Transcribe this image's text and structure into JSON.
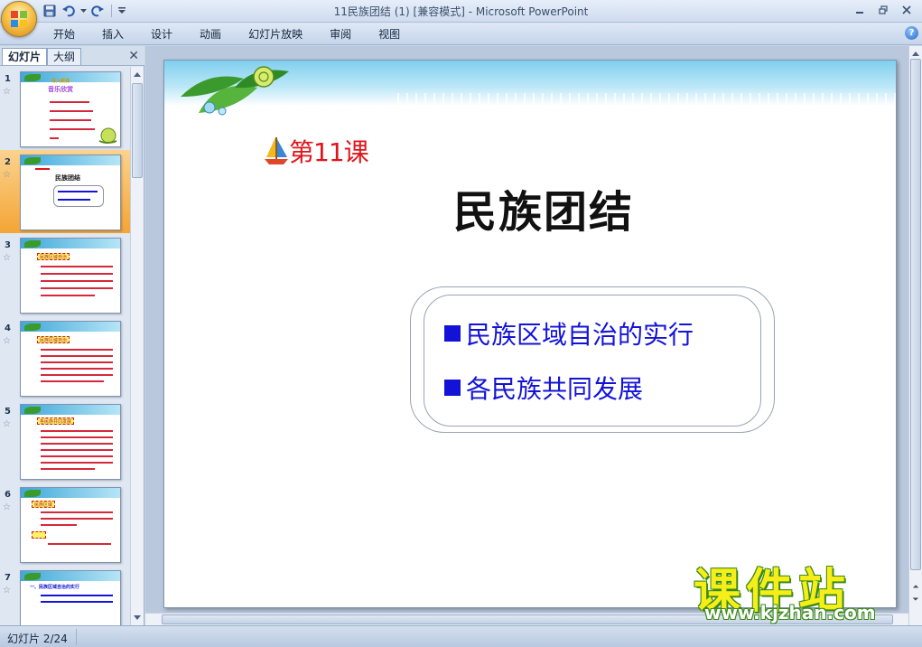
{
  "window": {
    "title": "11民族团结 (1) [兼容模式] - Microsoft PowerPoint"
  },
  "qat": {
    "icons": [
      "save-icon",
      "undo-icon",
      "dropdown-arrow-icon",
      "redo-icon",
      "customize-icon"
    ]
  },
  "ribbon": {
    "tabs": [
      {
        "label": "开始"
      },
      {
        "label": "插入"
      },
      {
        "label": "设计"
      },
      {
        "label": "动画"
      },
      {
        "label": "幻灯片放映"
      },
      {
        "label": "审阅"
      },
      {
        "label": "视图"
      }
    ],
    "help": "?"
  },
  "panel": {
    "tabs": [
      {
        "label": "幻灯片"
      },
      {
        "label": "大纲"
      }
    ],
    "close": "✕",
    "slides": [
      {
        "number": "1",
        "star": "☆",
        "title": "音乐欣赏",
        "subtitle": "导入新课"
      },
      {
        "number": "2",
        "star": "☆",
        "title": "民族团结",
        "selected": true
      },
      {
        "number": "3",
        "star": "☆",
        "label": "民族区域自治"
      },
      {
        "number": "4",
        "star": "☆",
        "label": "民族区域自治"
      },
      {
        "number": "5",
        "star": "☆",
        "label": "各民族共同发展"
      },
      {
        "number": "6",
        "star": "☆",
        "label": "民族区域"
      },
      {
        "number": "7",
        "star": "☆",
        "title": "一、民族区域自治的实行"
      }
    ]
  },
  "slide": {
    "lesson_label": "第11课",
    "title": "民族团结",
    "bullets": [
      {
        "text": "民族区域自治的实行"
      },
      {
        "text": "各民族共同发展"
      }
    ]
  },
  "status": {
    "slide_indicator": "幻灯片 2/24"
  },
  "watermark": {
    "text": "课件站",
    "url": "www.kjzhan.com"
  },
  "colors": {
    "accent_red": "#e0141b",
    "bullet_blue": "#1313d8",
    "selected_thumb": "#f4a535"
  }
}
